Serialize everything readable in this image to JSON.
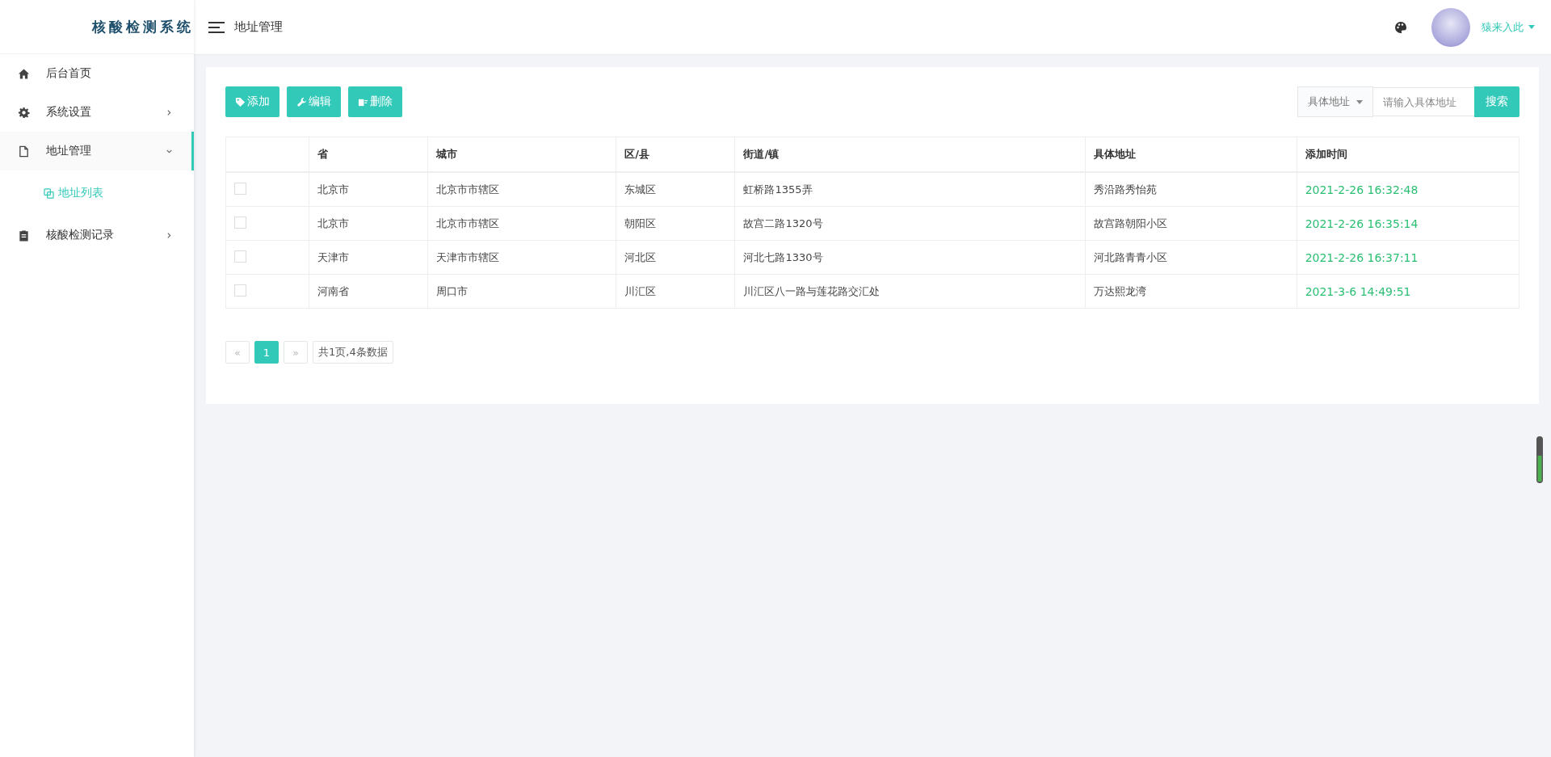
{
  "logo": "核酸检测系统",
  "header": {
    "title": "地址管理",
    "user": "猿来入此"
  },
  "sidebar": {
    "items": [
      {
        "label": "后台首页",
        "selected": false
      },
      {
        "label": "系统设置",
        "expanded": false,
        "selected": false
      },
      {
        "label": "地址管理",
        "expanded": true,
        "selected": true,
        "children": [
          {
            "label": "地址列表",
            "selected": true
          }
        ]
      },
      {
        "label": "核酸检测记录",
        "expanded": false,
        "selected": false
      }
    ]
  },
  "toolbar": {
    "buttons": [
      {
        "label": "添加"
      },
      {
        "label": "编辑"
      },
      {
        "label": "删除"
      }
    ],
    "search": {
      "field": "具体地址",
      "placeholder": "请输入具体地址",
      "button": "搜索"
    }
  },
  "table": {
    "columns": [
      "省",
      "城市",
      "区/县",
      "街道/镇",
      "具体地址",
      "添加时间"
    ],
    "rows": [
      {
        "checked": false,
        "cells": [
          "北京市",
          "北京市市辖区",
          "东城区",
          "虹桥路1355弄",
          "秀沿路秀怡苑",
          "2021-2-26 16:32:48"
        ]
      },
      {
        "checked": false,
        "cells": [
          "北京市",
          "北京市市辖区",
          "朝阳区",
          "故宫二路1320号",
          "故宫路朝阳小区",
          "2021-2-26 16:35:14"
        ]
      },
      {
        "checked": false,
        "cells": [
          "天津市",
          "天津市市辖区",
          "河北区",
          "河北七路1330号",
          "河北路青青小区",
          "2021-2-26 16:37:11"
        ]
      },
      {
        "checked": false,
        "cells": [
          "河南省",
          "周口市",
          "川汇区",
          "川汇区八一路与莲花路交汇处",
          "万达熙龙湾",
          "2021-3-6 14:49:51"
        ]
      }
    ]
  },
  "pagination": {
    "prev": "«",
    "pages": [
      {
        "label": "1",
        "selected": true
      }
    ],
    "next": "»",
    "summary": "共1页,4条数据"
  }
}
